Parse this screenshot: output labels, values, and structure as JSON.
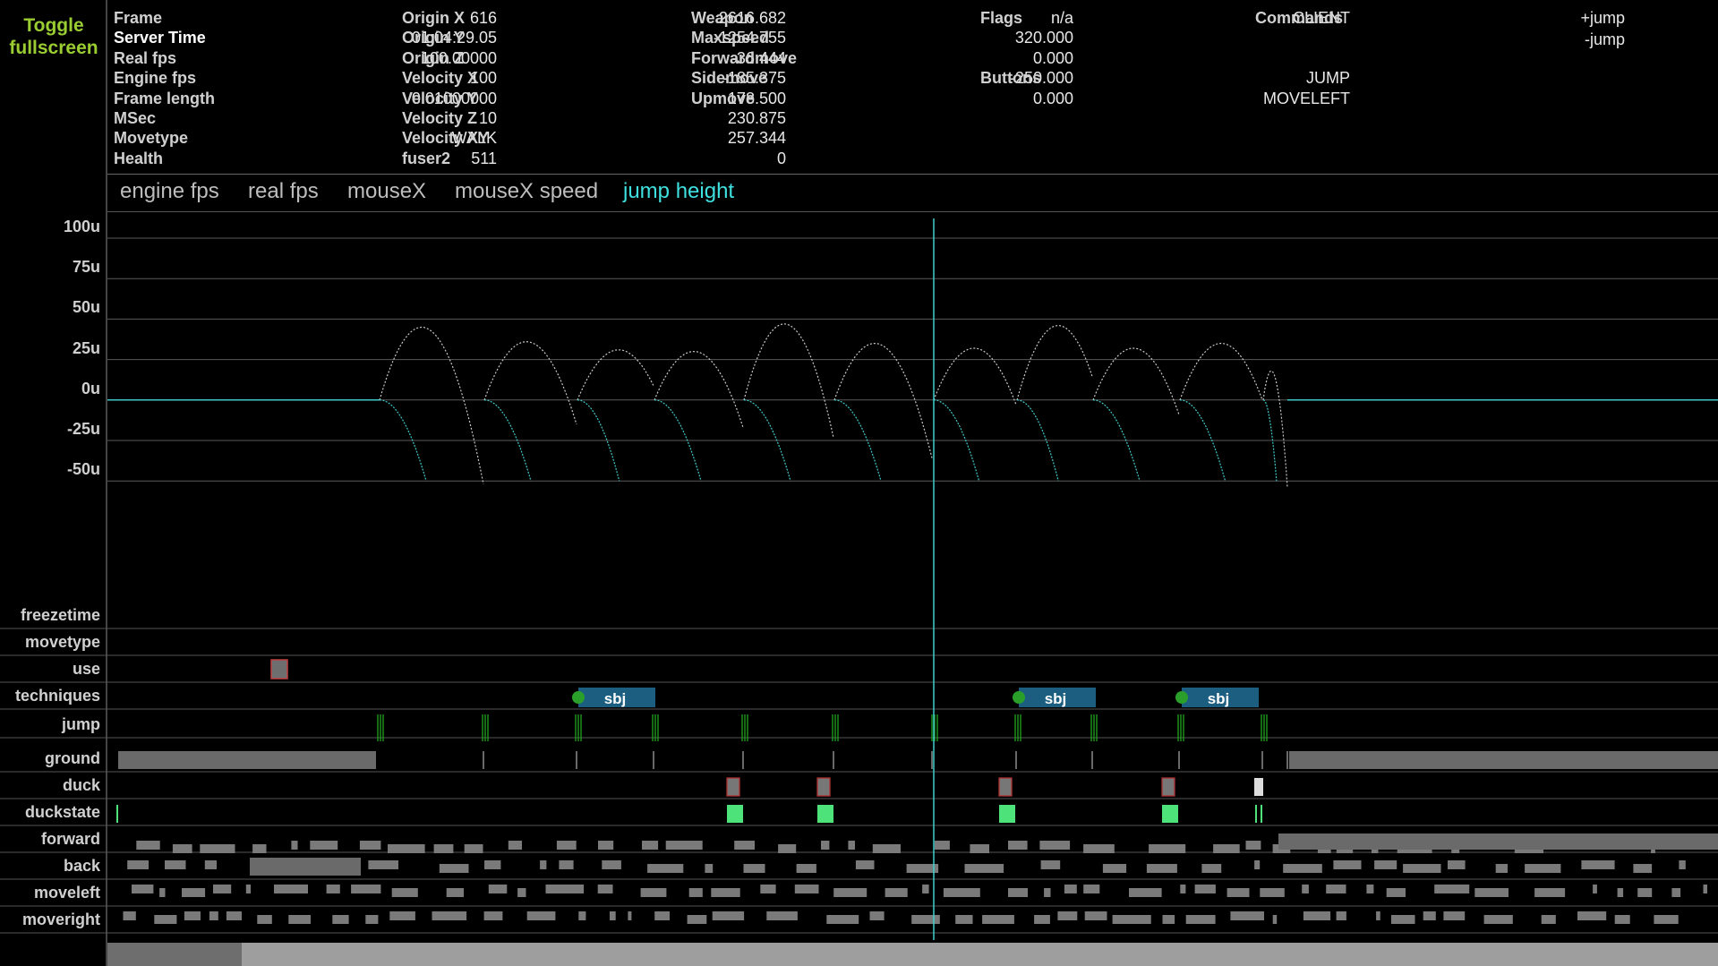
{
  "toggle": {
    "line1": "Toggle",
    "line2": "fullscreen"
  },
  "info": {
    "col1": [
      {
        "label": "Frame",
        "value": "616",
        "white": false
      },
      {
        "label": "Server Time",
        "value": "01:04:29.05",
        "white": true
      },
      {
        "label": "Real fps",
        "value": "100.00000",
        "white": false
      },
      {
        "label": "Engine fps",
        "value": "100",
        "white": false
      },
      {
        "label": "Frame length",
        "value": "0.01000000",
        "white": false
      },
      {
        "label": "MSec",
        "value": "10",
        "white": false
      },
      {
        "label": "Movetype",
        "value": "WALK",
        "white": false
      },
      {
        "label": "Health",
        "value": "511",
        "white": false
      }
    ],
    "col2": [
      {
        "label": "Origin X",
        "value": "2616.682"
      },
      {
        "label": "Origin Y",
        "value": "-1254.755"
      },
      {
        "label": "Origin Z",
        "value": "-36.444"
      },
      {
        "label": "Velocity X",
        "value": "-185.375"
      },
      {
        "label": "Velocity Y",
        "value": "178.500"
      },
      {
        "label": "Velocity Z",
        "value": "230.875"
      },
      {
        "label": "Velocity XY",
        "value": "257.344"
      },
      {
        "label": "fuser2",
        "value": "0"
      }
    ],
    "col3": [
      {
        "label": "Weapon",
        "value": "n/a"
      },
      {
        "label": "Maxspeed",
        "value": "320.000"
      },
      {
        "label": "Forwardmove",
        "value": "0.000"
      },
      {
        "label": "Sidemove",
        "value": "-250.000"
      },
      {
        "label": "Upmove",
        "value": "0.000"
      }
    ],
    "flags": {
      "label": "Flags",
      "values": [
        "CLIENT"
      ]
    },
    "buttons": {
      "label": "Buttons",
      "values": [
        "JUMP",
        "MOVELEFT"
      ]
    },
    "commands": {
      "label": "Commands",
      "values": [
        "+jump",
        "-jump"
      ]
    }
  },
  "tabs": [
    {
      "label": "engine fps",
      "active": false
    },
    {
      "label": "real fps",
      "active": false
    },
    {
      "label": "mouseX",
      "active": false
    },
    {
      "label": "mouseX speed",
      "active": false
    },
    {
      "label": "jump height",
      "active": true
    }
  ],
  "graph": {
    "y_labels": [
      "100u",
      "75u",
      "50u",
      "25u",
      "0u",
      "-25u",
      "-50u"
    ],
    "ylim": [
      -50,
      100
    ],
    "jumps": [
      {
        "start": 424,
        "peak_x": 471,
        "peak_h": 45,
        "end_x": 540
      },
      {
        "start": 541,
        "peak_x": 588,
        "peak_h": 36,
        "end_x": 644
      },
      {
        "start": 645,
        "peak_x": 691,
        "peak_h": 31,
        "end_x": 730
      },
      {
        "start": 731,
        "peak_x": 775,
        "peak_h": 30,
        "end_x": 830
      },
      {
        "start": 831,
        "peak_x": 876,
        "peak_h": 47,
        "end_x": 931
      },
      {
        "start": 932,
        "peak_x": 977,
        "peak_h": 35,
        "end_x": 1041
      },
      {
        "start": 1043,
        "peak_x": 1088,
        "peak_h": 32,
        "end_x": 1135
      },
      {
        "start": 1136,
        "peak_x": 1182,
        "peak_h": 46,
        "end_x": 1220
      },
      {
        "start": 1221,
        "peak_x": 1266,
        "peak_h": 32,
        "end_x": 1317
      },
      {
        "start": 1318,
        "peak_x": 1364,
        "peak_h": 35,
        "end_x": 1410
      },
      {
        "start": 1411,
        "peak_x": 1420,
        "peak_h": 18,
        "end_x": 1438
      }
    ],
    "cursor_x": 1043,
    "line_color": "#3fc8c8",
    "arc_color": "#c8c8c8"
  },
  "timeline": {
    "rows": [
      "freezetime",
      "movetype",
      "use",
      "techniques",
      "jump",
      "ground",
      "duck",
      "duckstate",
      "forward",
      "back",
      "moveleft",
      "moveright"
    ],
    "techniques": [
      {
        "x": 646,
        "label": "sbj"
      },
      {
        "x": 1138,
        "label": "sbj"
      },
      {
        "x": 1320,
        "label": "sbj"
      }
    ],
    "colors": {
      "tech_fill": "#1b5e80",
      "tech_dot": "#2aa02a",
      "jump": "#1fa51f",
      "ground": "#6a6a6a",
      "duckstate": "#4de37a",
      "key": "#7a7a7a"
    }
  }
}
